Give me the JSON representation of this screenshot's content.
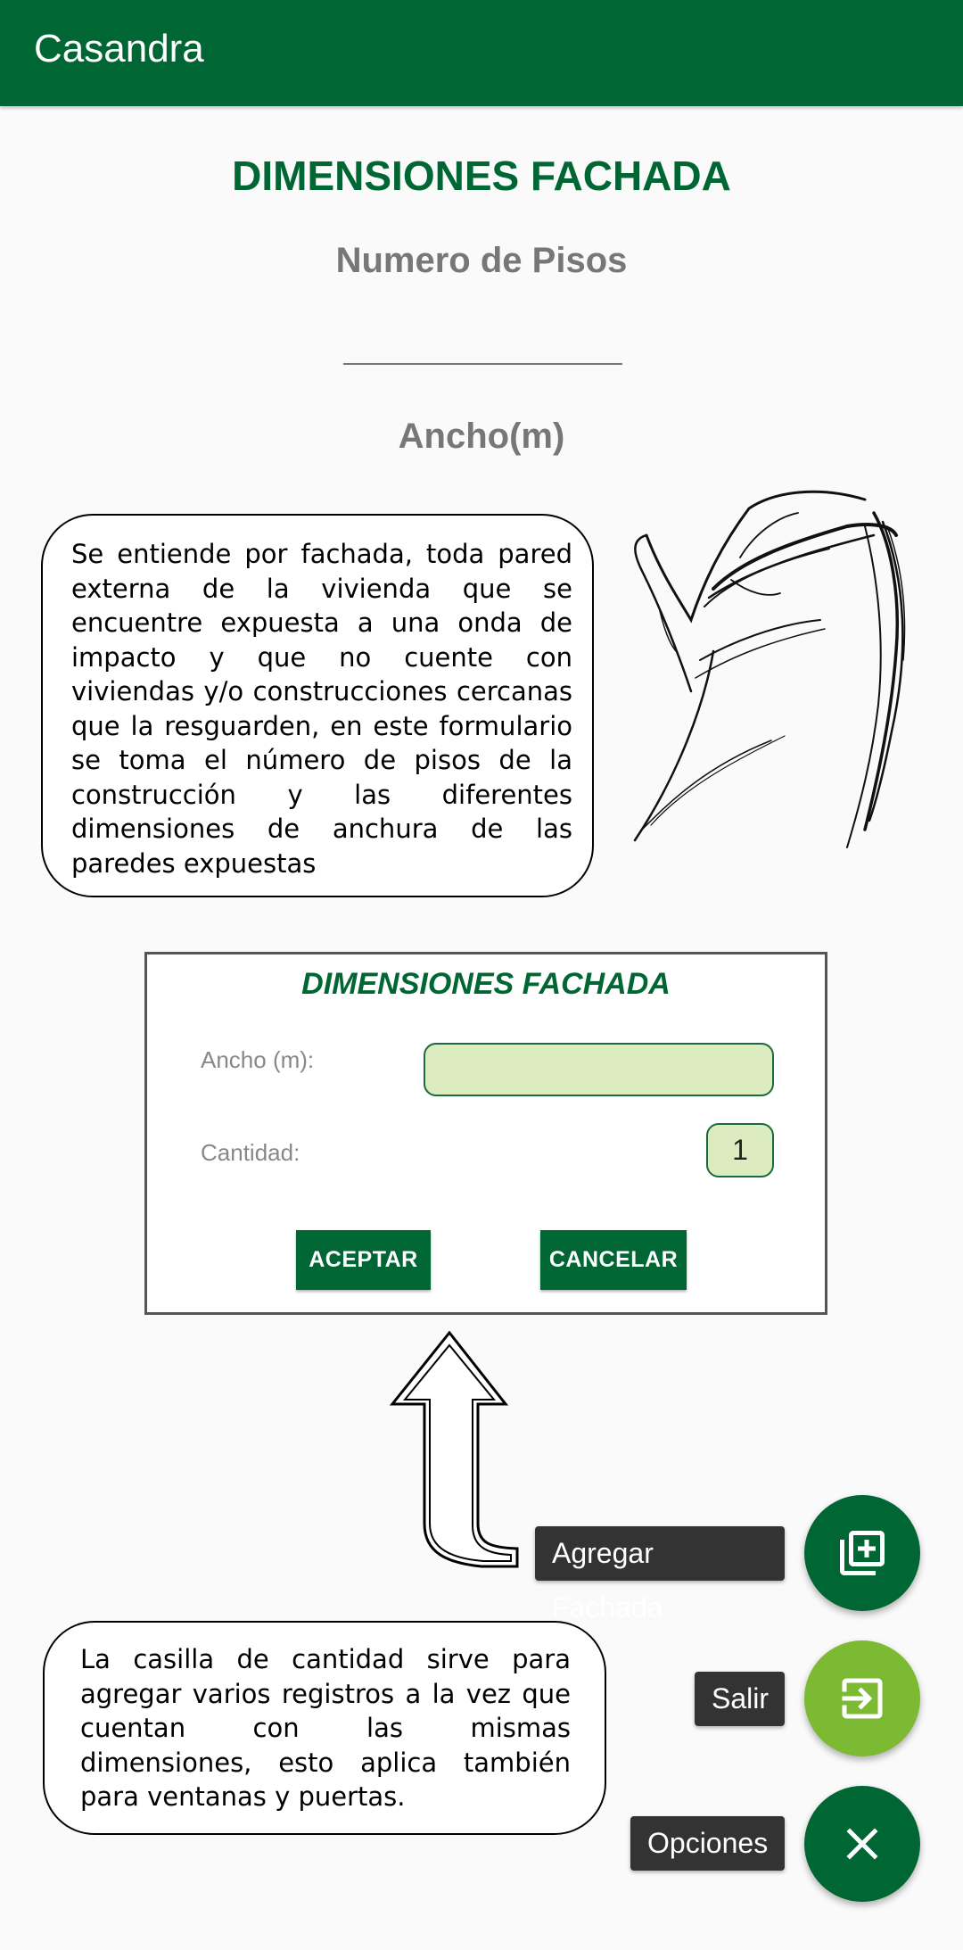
{
  "app": {
    "title": "Casandra"
  },
  "form": {
    "title": "DIMENSIONES FACHADA",
    "floors_label": "Numero de Pisos",
    "floors_value": "",
    "width_label": "Ancho(m)"
  },
  "help": {
    "facade_text": "Se entiende por fachada, toda pared externa de la vivienda que se encuentre expuesta a una onda de impacto y que no cuente con viviendas y/o construcciones cercanas que la resguarden, en este formulario se toma el número de pisos de la construcción y las diferentes dimensiones de anchura de las paredes expuestas",
    "quantity_text": "La casilla de cantidad sirve para agregar varios registros a la vez que cuentan con las mismas dimensiones, esto aplica también para ventanas y puertas."
  },
  "dialog": {
    "title": "DIMENSIONES FACHADA",
    "width_label": "Ancho (m):",
    "width_value": "",
    "quantity_label": "Cantidad:",
    "quantity_value": "1",
    "accept_label": "ACEPTAR",
    "cancel_label": "CANCELAR"
  },
  "fab_menu": {
    "add_label": "Agregar Fachada",
    "add_icon": "add-box-icon",
    "exit_label": "Salir",
    "exit_icon": "exit-icon",
    "options_label": "Opciones",
    "options_icon": "close-icon"
  },
  "colors": {
    "primary": "#006633",
    "accent": "#7dba33",
    "field_bg": "#dcecc0"
  }
}
